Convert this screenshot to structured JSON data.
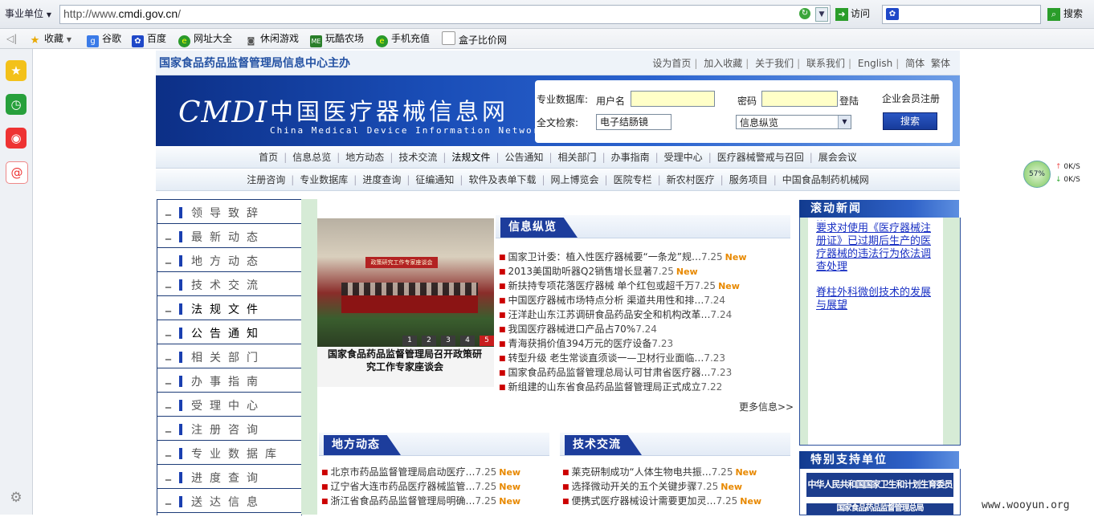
{
  "browser": {
    "scope_label": "事业单位",
    "url_prefix": "http://www.",
    "url_domain": "cmdi.gov.cn",
    "url_suffix": "/",
    "go_label": "访问",
    "search_label": "搜索",
    "favorites": {
      "collect": "收藏",
      "items": [
        "谷歌",
        "百度",
        "网址大全",
        "休闲游戏",
        "玩酷农场",
        "手机充值",
        "盒子比价网"
      ]
    }
  },
  "speed": {
    "percent": "57%",
    "up": "0K/S",
    "down": "0K/S"
  },
  "header": {
    "org": "国家食品药品监督管理局信息中心主办",
    "links": [
      "设为首页",
      "加入收藏",
      "关于我们",
      "联系我们",
      "English",
      "简体",
      "繁体"
    ]
  },
  "banner": {
    "logo": "CMDI",
    "name_cn": "中国医疗器械信息网",
    "name_en": "China Medical Device Information Network"
  },
  "login": {
    "db_label": "专业数据库:",
    "username_label": "用户名",
    "password_label": "密码",
    "login_label": "登陆",
    "register_label": "企业会员注册",
    "fulltext_label": "全文检索:",
    "search_value": "电子结肠镜",
    "select_value": "信息纵览",
    "search_button": "搜索"
  },
  "nav1": [
    "首页",
    "信息总览",
    "地方动态",
    "技术交流",
    "法规文件",
    "公告通知",
    "相关部门",
    "办事指南",
    "受理中心",
    "医疗器械警戒与召回",
    "展会会议"
  ],
  "nav2": [
    "注册咨询",
    "专业数据库",
    "进度查询",
    "征编通知",
    "软件及表单下载",
    "网上博览会",
    "医院专栏",
    "新农村医疗",
    "服务项目",
    "中国食品制药机械网"
  ],
  "left_menu": [
    "领导致辞",
    "最新动态",
    "地方动态",
    "技术交流",
    "法规文件",
    "公告通知",
    "相关部门",
    "办事指南",
    "受理中心",
    "注册咨询",
    "专业数据库",
    "进度查询",
    "送达信息"
  ],
  "left_menu_mark": "_",
  "photo": {
    "banner_text": "政策研究工作专家座谈会",
    "pages": [
      "1",
      "2",
      "3",
      "4",
      "5"
    ],
    "caption": "国家食品药品监督管理局召开政策研究工作专家座谈会"
  },
  "sections": {
    "info": {
      "title": "信息纵览",
      "items": [
        {
          "text": "国家卫计委：植入性医疗器械要“一条龙”规…",
          "date": "7.25",
          "new": "New"
        },
        {
          "text": "2013美国助听器Q2销售增长显著",
          "date": "7.25",
          "new": "New"
        },
        {
          "text": "新扶持专项花落医疗器械 单个红包或超千万",
          "date": "7.25",
          "new": "New"
        },
        {
          "text": "中国医疗器械市场特点分析 渠道共用性和排…",
          "date": "7.24",
          "new": ""
        },
        {
          "text": "汪洋赴山东江苏调研食品药品安全和机构改革…",
          "date": "7.24",
          "new": ""
        },
        {
          "text": "我国医疗器械进口产品占70%",
          "date": "7.24",
          "new": ""
        },
        {
          "text": "青海获捐价值394万元的医疗设备",
          "date": "7.23",
          "new": ""
        },
        {
          "text": "转型升级 老生常谈直须谈一—卫材行业面临…",
          "date": "7.23",
          "new": ""
        },
        {
          "text": "国家食品药品监督管理总局认可甘肃省医疗器…",
          "date": "7.23",
          "new": ""
        },
        {
          "text": "新组建的山东省食品药品监督管理局正式成立",
          "date": "7.22",
          "new": ""
        }
      ],
      "more": "更多信息>>"
    },
    "local": {
      "title": "地方动态",
      "items": [
        {
          "text": "北京市药品监督管理局启动医疗…",
          "date": "7.25",
          "new": "New"
        },
        {
          "text": "辽宁省大连市药品医疗器械监管…",
          "date": "7.25",
          "new": "New"
        },
        {
          "text": "浙江省食品药品监督管理局明确…",
          "date": "7.25",
          "new": "New"
        }
      ]
    },
    "tech": {
      "title": "技术交流",
      "items": [
        {
          "text": "莱克研制成功“人体生物电共振…",
          "date": "7.25",
          "new": "New"
        },
        {
          "text": "选择微动开关的五个关键步骤",
          "date": "7.25",
          "new": "New"
        },
        {
          "text": "便携式医疗器械设计需要更加灵…",
          "date": "7.25",
          "new": "New"
        }
      ]
    }
  },
  "right": {
    "scroll_title": "滚动新闻",
    "scroll_items": [
      "要求对使用《医疗器械注册证》已过期后生产的医疗器械的违法行为依法调查处理",
      "脊柱外科微创技术的发展与展望"
    ],
    "support_title": "特别支持单位",
    "support_logos": [
      "中华人民共和国国家卫生和计划生育委员会",
      "国家食品药品监督管理总局"
    ]
  },
  "watermark": "www.wooyun.org"
}
